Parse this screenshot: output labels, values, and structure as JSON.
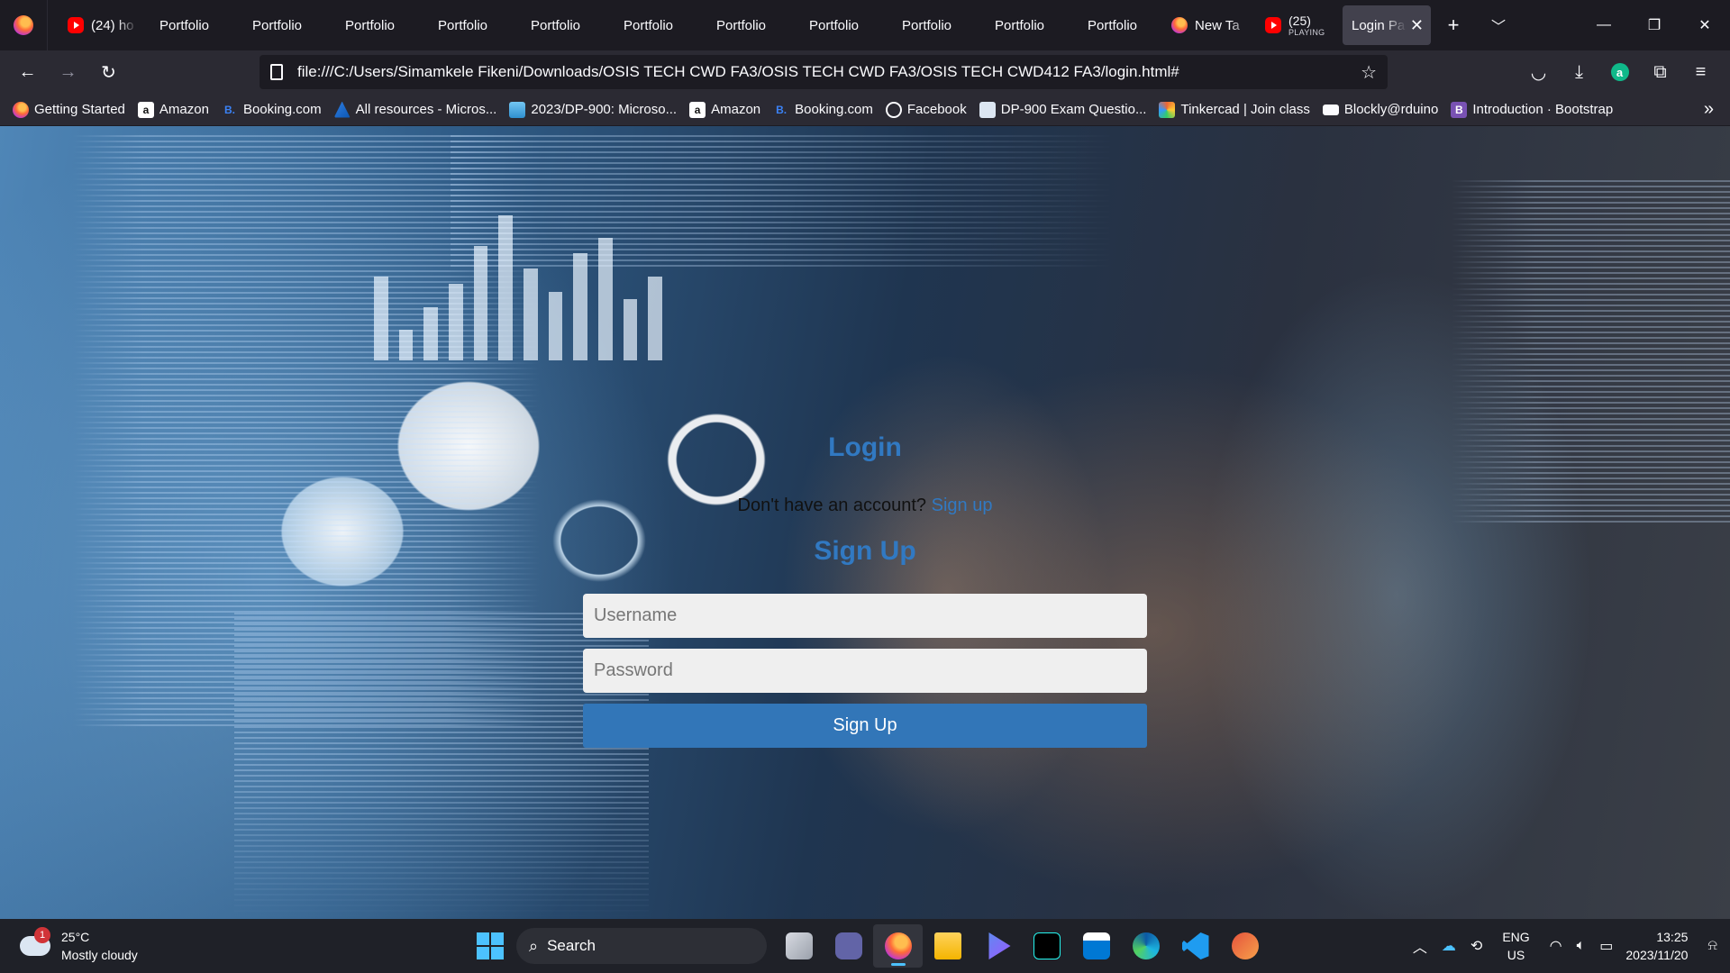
{
  "browser": {
    "tabs": [
      {
        "label": "(24) ho",
        "icon": "youtube-icon"
      },
      {
        "label": "Portfolio"
      },
      {
        "label": "Portfolio"
      },
      {
        "label": "Portfolio"
      },
      {
        "label": "Portfolio"
      },
      {
        "label": "Portfolio"
      },
      {
        "label": "Portfolio"
      },
      {
        "label": "Portfolio"
      },
      {
        "label": "Portfolio"
      },
      {
        "label": "Portfolio"
      },
      {
        "label": "Portfolio"
      },
      {
        "label": "Portfolio"
      },
      {
        "label": "New Ta",
        "icon": "firefox-icon"
      },
      {
        "label": "(25)",
        "sublabel": "PLAYING",
        "icon": "youtube-icon"
      },
      {
        "label": "Login Pa",
        "icon": "close-icon",
        "active": true
      }
    ],
    "url": "file:///C:/Users/Simamkele Fikeni/Downloads/OSIS TECH CWD FA3/OSIS TECH CWD FA3/OSIS TECH CWD412 FA3/login.html#",
    "bookmarks": [
      {
        "label": "Getting Started",
        "icon": "firefox-icon"
      },
      {
        "label": "Amazon",
        "icon": "amazon-icon"
      },
      {
        "label": "Booking.com",
        "icon": "booking-icon"
      },
      {
        "label": "All resources - Micros...",
        "icon": "azure-icon"
      },
      {
        "label": "2023/DP-900: Microso...",
        "icon": "learn-icon"
      },
      {
        "label": "Amazon",
        "icon": "amazon-icon"
      },
      {
        "label": "Booking.com",
        "icon": "booking-icon"
      },
      {
        "label": "Facebook",
        "icon": "globe-icon"
      },
      {
        "label": "DP-900 Exam Questio...",
        "icon": "exam-icon"
      },
      {
        "label": "Tinkercad | Join class",
        "icon": "tinkercad-icon"
      },
      {
        "label": "Blockly@rduino",
        "icon": "blockly-icon"
      },
      {
        "label": "Introduction · Bootstrap",
        "icon": "bootstrap-icon"
      }
    ]
  },
  "page": {
    "login_title": "Login",
    "signup_prompt": "Don't have an account?",
    "signup_link": "Sign up",
    "signup_title": "Sign Up",
    "username_placeholder": "Username",
    "password_placeholder": "Password",
    "signup_button": "Sign Up",
    "accent_color": "#3179c2"
  },
  "taskbar": {
    "weather_temp": "25°C",
    "weather_desc": "Mostly cloudy",
    "weather_badge": "1",
    "search_label": "Search",
    "lang_1": "ENG",
    "lang_2": "US",
    "time": "13:25",
    "date": "2023/11/20"
  }
}
